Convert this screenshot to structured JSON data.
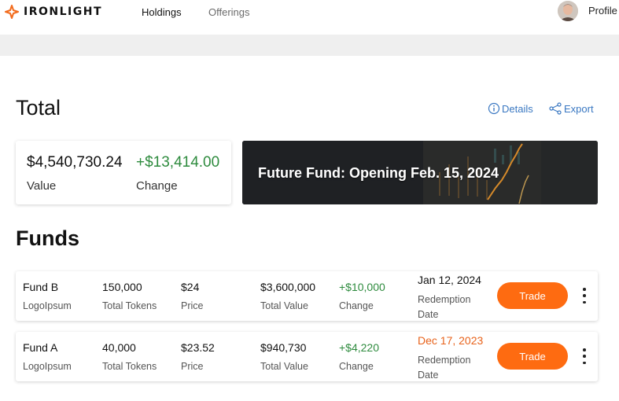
{
  "nav": {
    "brand": "IRONLIGHT",
    "items": [
      {
        "label": "Holdings"
      },
      {
        "label": "Offerings"
      }
    ],
    "profile_label": "Profile",
    "brand_color": "#f26a1b"
  },
  "total": {
    "heading": "Total",
    "details_label": "Details",
    "export_label": "Export",
    "value": "$4,540,730.24",
    "value_label": "Value",
    "change": "+$13,414.00",
    "change_label": "Change"
  },
  "banner": {
    "text": "Future Fund: Opening Feb. 15, 2024"
  },
  "funds": {
    "heading": "Funds",
    "rows": [
      {
        "name": "Fund B",
        "issuer": "LogoIpsum",
        "tokens": "150,000",
        "tokens_label": "Total Tokens",
        "price": "$24",
        "price_label": "Price",
        "total_value": "$3,600,000",
        "total_value_label": "Total Value",
        "change": "+$10,000",
        "change_label": "Change",
        "date": "Jan 12, 2024",
        "date_label": "Redemption Date",
        "trade_label": "Trade"
      },
      {
        "name": "Fund A",
        "issuer": "LogoIpsum",
        "tokens": "40,000",
        "tokens_label": "Total Tokens",
        "price": "$23.52",
        "price_label": "Price",
        "total_value": "$940,730",
        "total_value_label": "Total Value",
        "change": "+$4,220",
        "change_label": "Change",
        "date": "Dec 17, 2023",
        "date_label": "Redemption Date",
        "trade_label": "Trade"
      }
    ]
  },
  "colors": {
    "accent": "#fe6b11",
    "positive": "#2e8b3e",
    "link": "#3a78c2",
    "date_warning": "#e8631c"
  }
}
